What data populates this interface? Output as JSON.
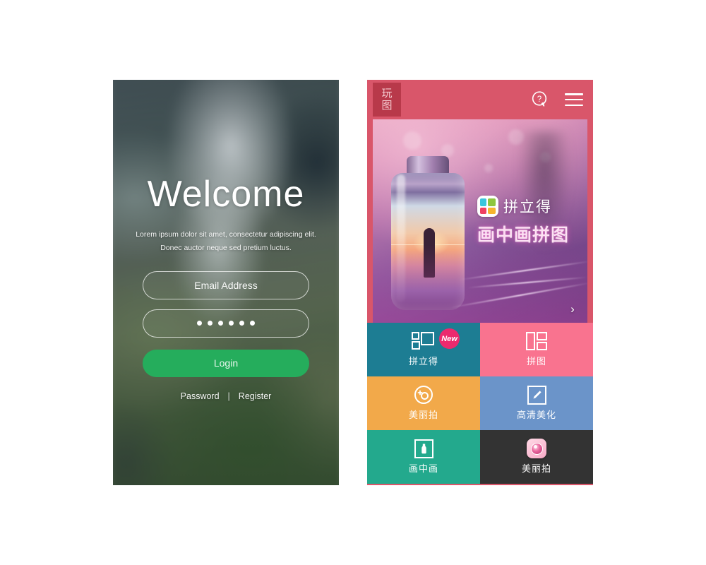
{
  "login_screen": {
    "title": "Welcome",
    "subtitle_line1": "Lorem ipsum dolor sit amet, consectetur adipiscing elit.",
    "subtitle_line2": "Donec auctor neque sed pretium luctus.",
    "email_placeholder": "Email Address",
    "email_value": "Email Address",
    "password_dots": 6,
    "password_masked": "••••••",
    "login_label": "Login",
    "links": {
      "password": "Password",
      "divider": "|",
      "register": "Register"
    },
    "colors": {
      "login_button": "#25ad5c",
      "text": "#ffffff"
    }
  },
  "home_screen": {
    "header": {
      "logo_line1": "玩",
      "logo_line2": "图",
      "logo_bg": "#b8394a",
      "bar_bg": "#d9566a",
      "help_icon": "question-bubble-icon",
      "menu_icon": "hamburger-menu-icon"
    },
    "banner": {
      "brand_name": "拼立得",
      "headline": "画中画拼图",
      "brand_icon": "collage-app-icon",
      "next_arrow": "›",
      "artwork": "bottle-with-sunset-silhouette"
    },
    "tiles": [
      {
        "label": "拼立得",
        "icon": "collage-grid-icon",
        "bg": "#1d7d93",
        "badge": "New",
        "badge_color": "#ec2a6e"
      },
      {
        "label": "拼图",
        "icon": "puzzle-layout-icon",
        "bg": "#f9738f",
        "badge": null
      },
      {
        "label": "美丽拍",
        "icon": "camera-circle-icon",
        "bg": "#f2a94a",
        "badge": null
      },
      {
        "label": "高清美化",
        "icon": "pencil-edit-icon",
        "bg": "#6b94c9",
        "badge": null
      },
      {
        "label": "画中画",
        "icon": "bottle-frame-icon",
        "bg": "#23a98d",
        "badge": null
      },
      {
        "label": "美丽拍",
        "icon": "beauty-camera-app-icon",
        "bg": "#333333",
        "badge": null
      }
    ]
  }
}
